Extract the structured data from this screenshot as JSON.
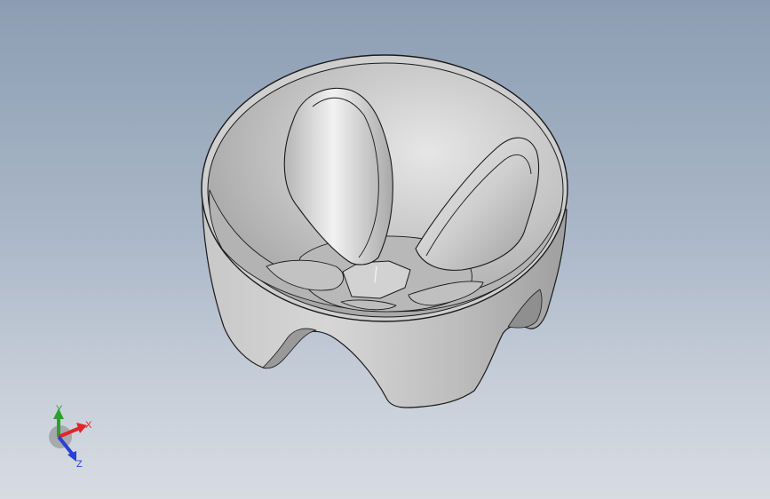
{
  "viewport": {
    "model": "bowl-part",
    "background_top": "#8c9db3",
    "background_bottom": "#d7dce3"
  },
  "triad": {
    "x_label": "X",
    "y_label": "Y",
    "z_label": "Z",
    "x_color": "#e0252b",
    "y_color": "#2aa12e",
    "z_color": "#2a3fd6"
  }
}
